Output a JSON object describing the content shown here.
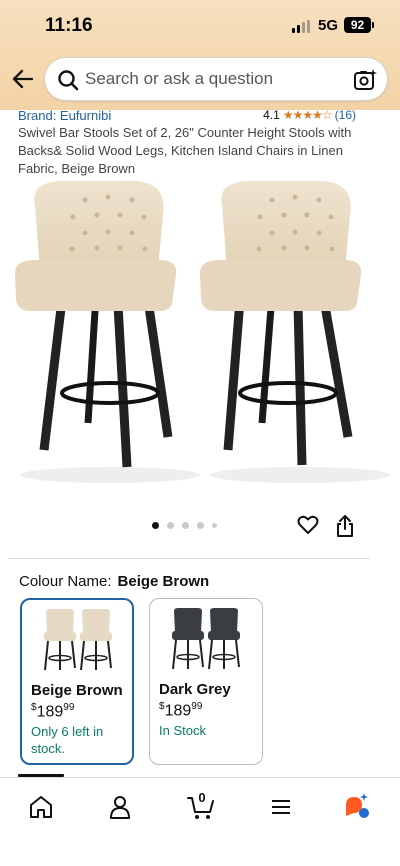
{
  "status_bar": {
    "time": "11:16",
    "network": "5G",
    "battery": "92"
  },
  "header": {
    "back_icon": "arrow-left-icon",
    "search_placeholder": "Search or ask a question",
    "camera_icon": "camera-scan-icon"
  },
  "product": {
    "brand": "Brand: Eufurnibi",
    "rating": "4.1",
    "stars": "★★★★☆",
    "rating_count": "(16)",
    "title": "Swivel Bar Stools Set of 2, 26\" Counter Height Stools with Backs& Solid Wood Legs, Kitchen Island Chairs in Linen Fabric, Beige Brown",
    "image_count": 5,
    "active_image": 1
  },
  "colour": {
    "label": "Colour Name:",
    "selected": "Beige Brown",
    "options": [
      {
        "name": "Beige Brown",
        "price_symbol": "$",
        "price_whole": "189",
        "price_fraction": "99",
        "stock": "Only 6 left in stock.",
        "selected": true
      },
      {
        "name": "Dark Grey",
        "price_symbol": "$",
        "price_whole": "189",
        "price_fraction": "99",
        "stock": "In Stock",
        "selected": false
      }
    ]
  },
  "bottom_nav": {
    "items": [
      "home-icon",
      "account-icon",
      "cart-icon",
      "menu-icon",
      "rufus-icon"
    ],
    "cart_count": "0"
  },
  "colors": {
    "link": "#2162a1",
    "stock": "#067d62",
    "star": "#de7921",
    "header_bg": "#f3d3a5"
  }
}
